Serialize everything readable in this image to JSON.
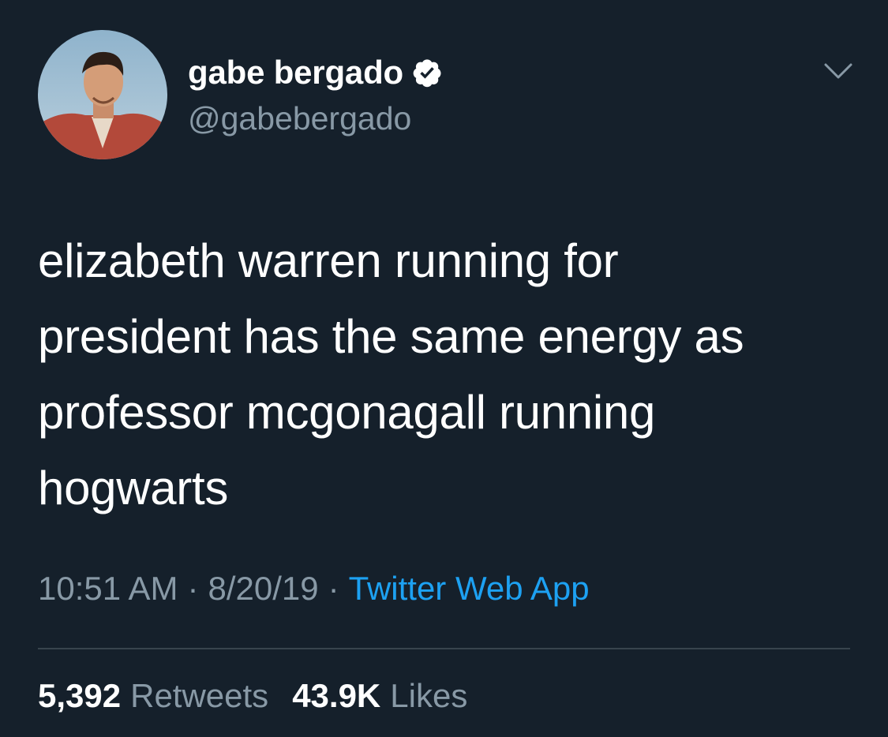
{
  "author": {
    "display_name": "gabe bergado",
    "handle": "@gabebergado",
    "verified": true
  },
  "tweet": {
    "lines": [
      "elizabeth warren running for",
      "president has the same energy as",
      "professor mcgonagall running",
      "hogwarts"
    ]
  },
  "meta": {
    "time": "10:51 AM",
    "separator": "·",
    "date": "8/20/19",
    "source": "Twitter Web App"
  },
  "stats": {
    "retweets_count": "5,392",
    "retweets_label": "Retweets",
    "likes_count": "43.9K",
    "likes_label": "Likes"
  },
  "icons": {
    "verified": "verified-badge-icon",
    "menu": "chevron-down-icon"
  },
  "colors": {
    "background": "#15202b",
    "primary_text": "#ffffff",
    "secondary_text": "#8899a6",
    "link": "#1da1f2",
    "divider": "#38444d"
  }
}
